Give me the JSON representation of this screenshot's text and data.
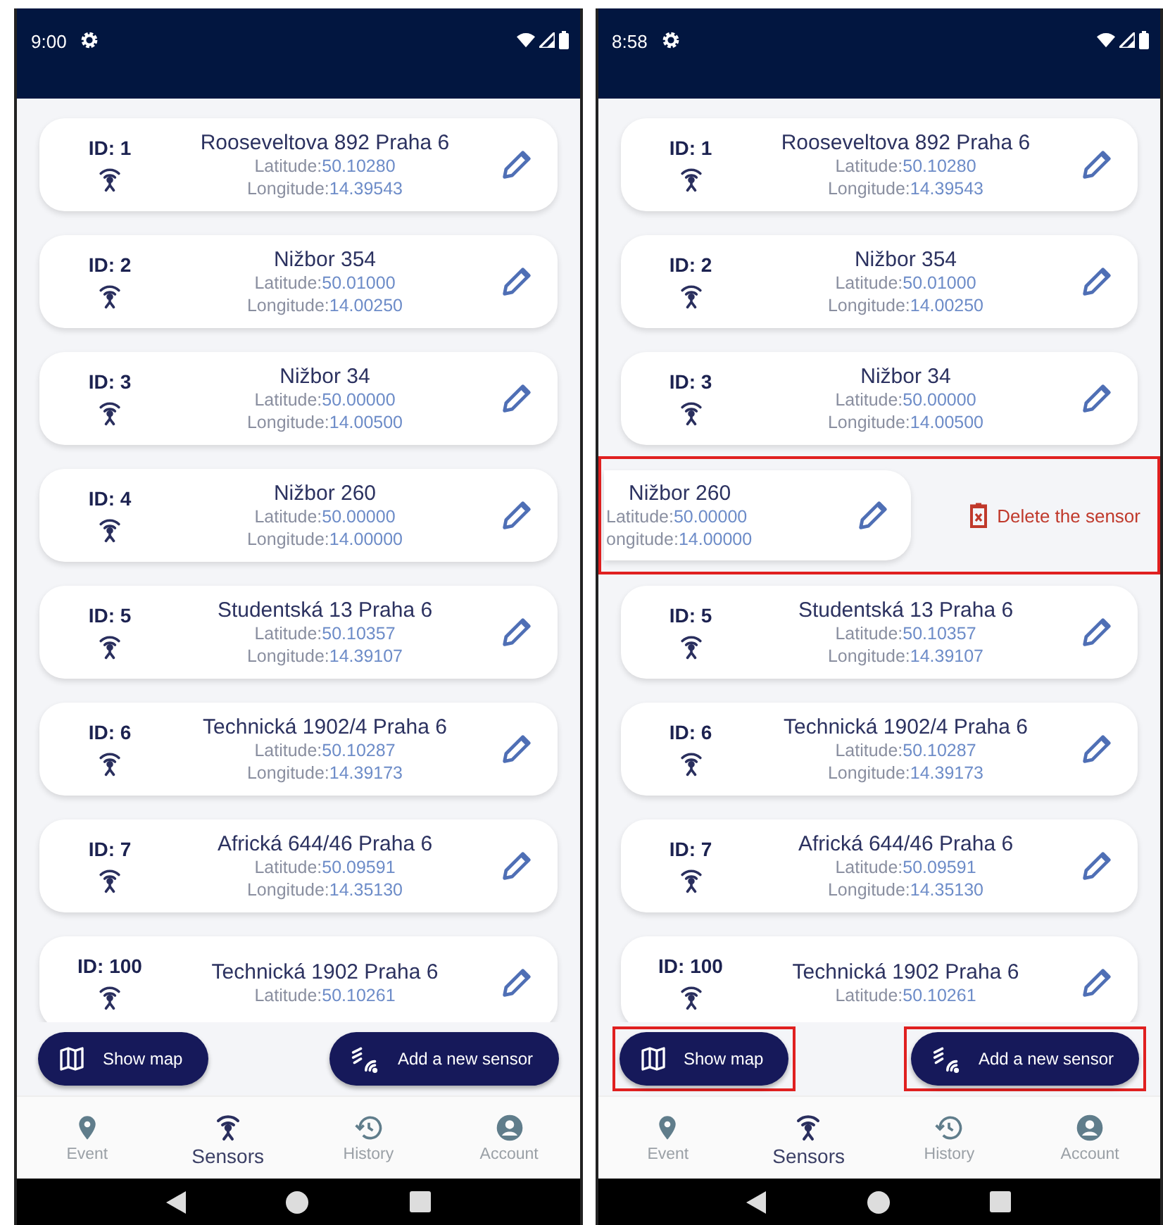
{
  "phones": [
    {
      "status_bar": {
        "time": "9:00"
      },
      "sensors": [
        {
          "id_label": "ID: 1",
          "address": "Rooseveltova 892 Praha 6",
          "latitude_label": "Latitude:",
          "latitude": "50.10280",
          "longitude_label": "Longitude:",
          "longitude": "14.39543",
          "swiped": false
        },
        {
          "id_label": "ID: 2",
          "address": "Nižbor 354",
          "latitude_label": "Latitude:",
          "latitude": "50.01000",
          "longitude_label": "Longitude:",
          "longitude": "14.00250",
          "swiped": false
        },
        {
          "id_label": "ID: 3",
          "address": "Nižbor 34",
          "latitude_label": "Latitude:",
          "latitude": "50.00000",
          "longitude_label": "Longitude:",
          "longitude": "14.00500",
          "swiped": false
        },
        {
          "id_label": "ID: 4",
          "address": "Nižbor 260",
          "latitude_label": "Latitude:",
          "latitude": "50.00000",
          "longitude_label": "Longitude:",
          "longitude": "14.00000",
          "swiped": false
        },
        {
          "id_label": "ID: 5",
          "address": "Studentská 13 Praha 6",
          "latitude_label": "Latitude:",
          "latitude": "50.10357",
          "longitude_label": "Longitude:",
          "longitude": "14.39107",
          "swiped": false
        },
        {
          "id_label": "ID: 6",
          "address": "Technická 1902/4 Praha 6",
          "latitude_label": "Latitude:",
          "latitude": "50.10287",
          "longitude_label": "Longitude:",
          "longitude": "14.39173",
          "swiped": false
        },
        {
          "id_label": "ID: 7",
          "address": "Africká 644/46 Praha 6",
          "latitude_label": "Latitude:",
          "latitude": "50.09591",
          "longitude_label": "Longitude:",
          "longitude": "14.35130",
          "swiped": false
        },
        {
          "id_label": "ID: 100",
          "address": "Technická 1902 Praha 6",
          "latitude_label": "Latitude:",
          "latitude": "50.10261",
          "swiped": false
        }
      ],
      "buttons": [
        {
          "kind": "map",
          "label": "Show map",
          "highlighted": false
        },
        {
          "kind": "add",
          "label": "Add a new sensor",
          "highlighted": false
        }
      ],
      "nav": [
        {
          "kind": "pin",
          "label": "Event",
          "selected": false
        },
        {
          "kind": "antenna",
          "label": "Sensors",
          "selected": true
        },
        {
          "kind": "history",
          "label": "History",
          "selected": false
        },
        {
          "kind": "account",
          "label": "Account",
          "selected": false
        }
      ]
    },
    {
      "status_bar": {
        "time": "8:58"
      },
      "sensors": [
        {
          "id_label": "ID: 1",
          "address": "Rooseveltova 892 Praha 6",
          "latitude_label": "Latitude:",
          "latitude": "50.10280",
          "longitude_label": "Longitude:",
          "longitude": "14.39543",
          "swiped": false
        },
        {
          "id_label": "ID: 2",
          "address": "Nižbor 354",
          "latitude_label": "Latitude:",
          "latitude": "50.01000",
          "longitude_label": "Longitude:",
          "longitude": "14.00250",
          "swiped": false
        },
        {
          "id_label": "ID: 3",
          "address": "Nižbor 34",
          "latitude_label": "Latitude:",
          "latitude": "50.00000",
          "longitude_label": "Longitude:",
          "longitude": "14.00500",
          "swiped": false
        },
        {
          "address": "Nižbor 260",
          "latitude_label": "Latitude:",
          "latitude": "50.00000",
          "longitude_label": "ongitude:",
          "longitude": "14.00000",
          "swiped": true,
          "action": "Delete the sensor",
          "highlighted": true
        },
        {
          "id_label": "ID: 5",
          "address": "Studentská 13 Praha 6",
          "latitude_label": "Latitude:",
          "latitude": "50.10357",
          "longitude_label": "Longitude:",
          "longitude": "14.39107",
          "swiped": false
        },
        {
          "id_label": "ID: 6",
          "address": "Technická 1902/4 Praha 6",
          "latitude_label": "Latitude:",
          "latitude": "50.10287",
          "longitude_label": "Longitude:",
          "longitude": "14.39173",
          "swiped": false
        },
        {
          "id_label": "ID: 7",
          "address": "Africká 644/46 Praha 6",
          "latitude_label": "Latitude:",
          "latitude": "50.09591",
          "longitude_label": "Longitude:",
          "longitude": "14.35130",
          "swiped": false
        },
        {
          "id_label": "ID: 100",
          "address": "Technická 1902 Praha 6",
          "latitude_label": "Latitude:",
          "latitude": "50.10261",
          "swiped": false
        }
      ],
      "buttons": [
        {
          "kind": "map",
          "label": "Show map",
          "highlighted": true
        },
        {
          "kind": "add",
          "label": "Add a new sensor",
          "highlighted": true
        }
      ],
      "nav": [
        {
          "kind": "pin",
          "label": "Event",
          "selected": false
        },
        {
          "kind": "antenna",
          "label": "Sensors",
          "selected": true
        },
        {
          "kind": "history",
          "label": "History",
          "selected": false
        },
        {
          "kind": "account",
          "label": "Account",
          "selected": false
        }
      ]
    }
  ]
}
